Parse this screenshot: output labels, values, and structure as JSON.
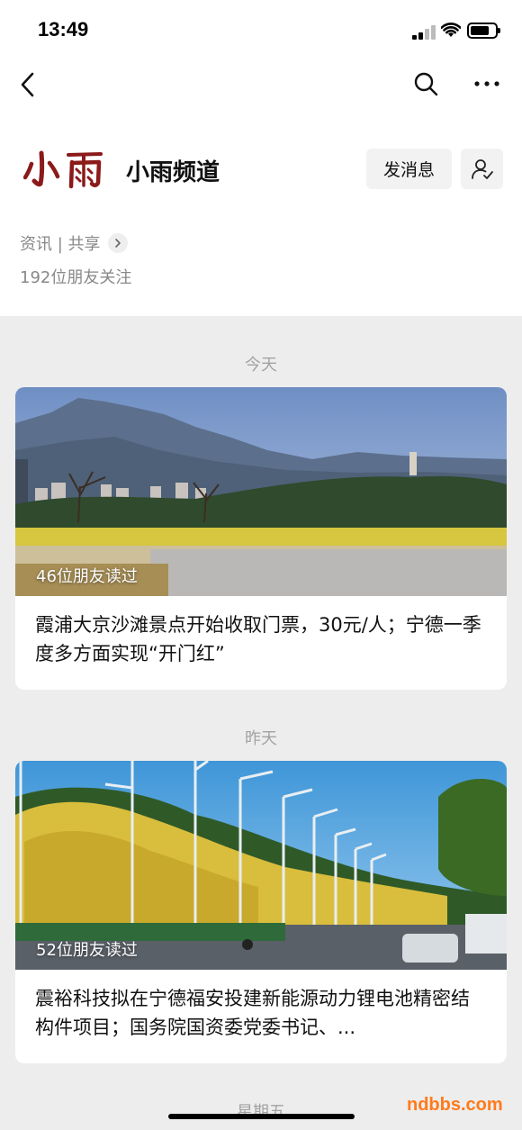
{
  "status_bar": {
    "time": "13:49"
  },
  "nav": {
    "back": "back",
    "search": "search",
    "more": "more"
  },
  "profile": {
    "logo_text": "小雨",
    "channel_name": "小雨频道",
    "message_button": "发消息",
    "category": "资讯 | 共享",
    "followers": "192位朋友关注"
  },
  "feed": [
    {
      "day": "今天",
      "read_count": "46位朋友读过",
      "title": "霞浦大京沙滩景点开始收取门票，30元/人；宁德一季度多方面实现“开门红”"
    },
    {
      "day": "昨天",
      "read_count": "52位朋友读过",
      "title": "震裕科技拟在宁德福安投建新能源动力锂电池精密结构件项目；国务院国资委党委书记、..."
    }
  ],
  "next_day": "星期五",
  "watermark": "ndbbs.com",
  "colors": {
    "logo": "#8b1a1a",
    "accent": "#ff7a1a",
    "background": "#ededed"
  }
}
